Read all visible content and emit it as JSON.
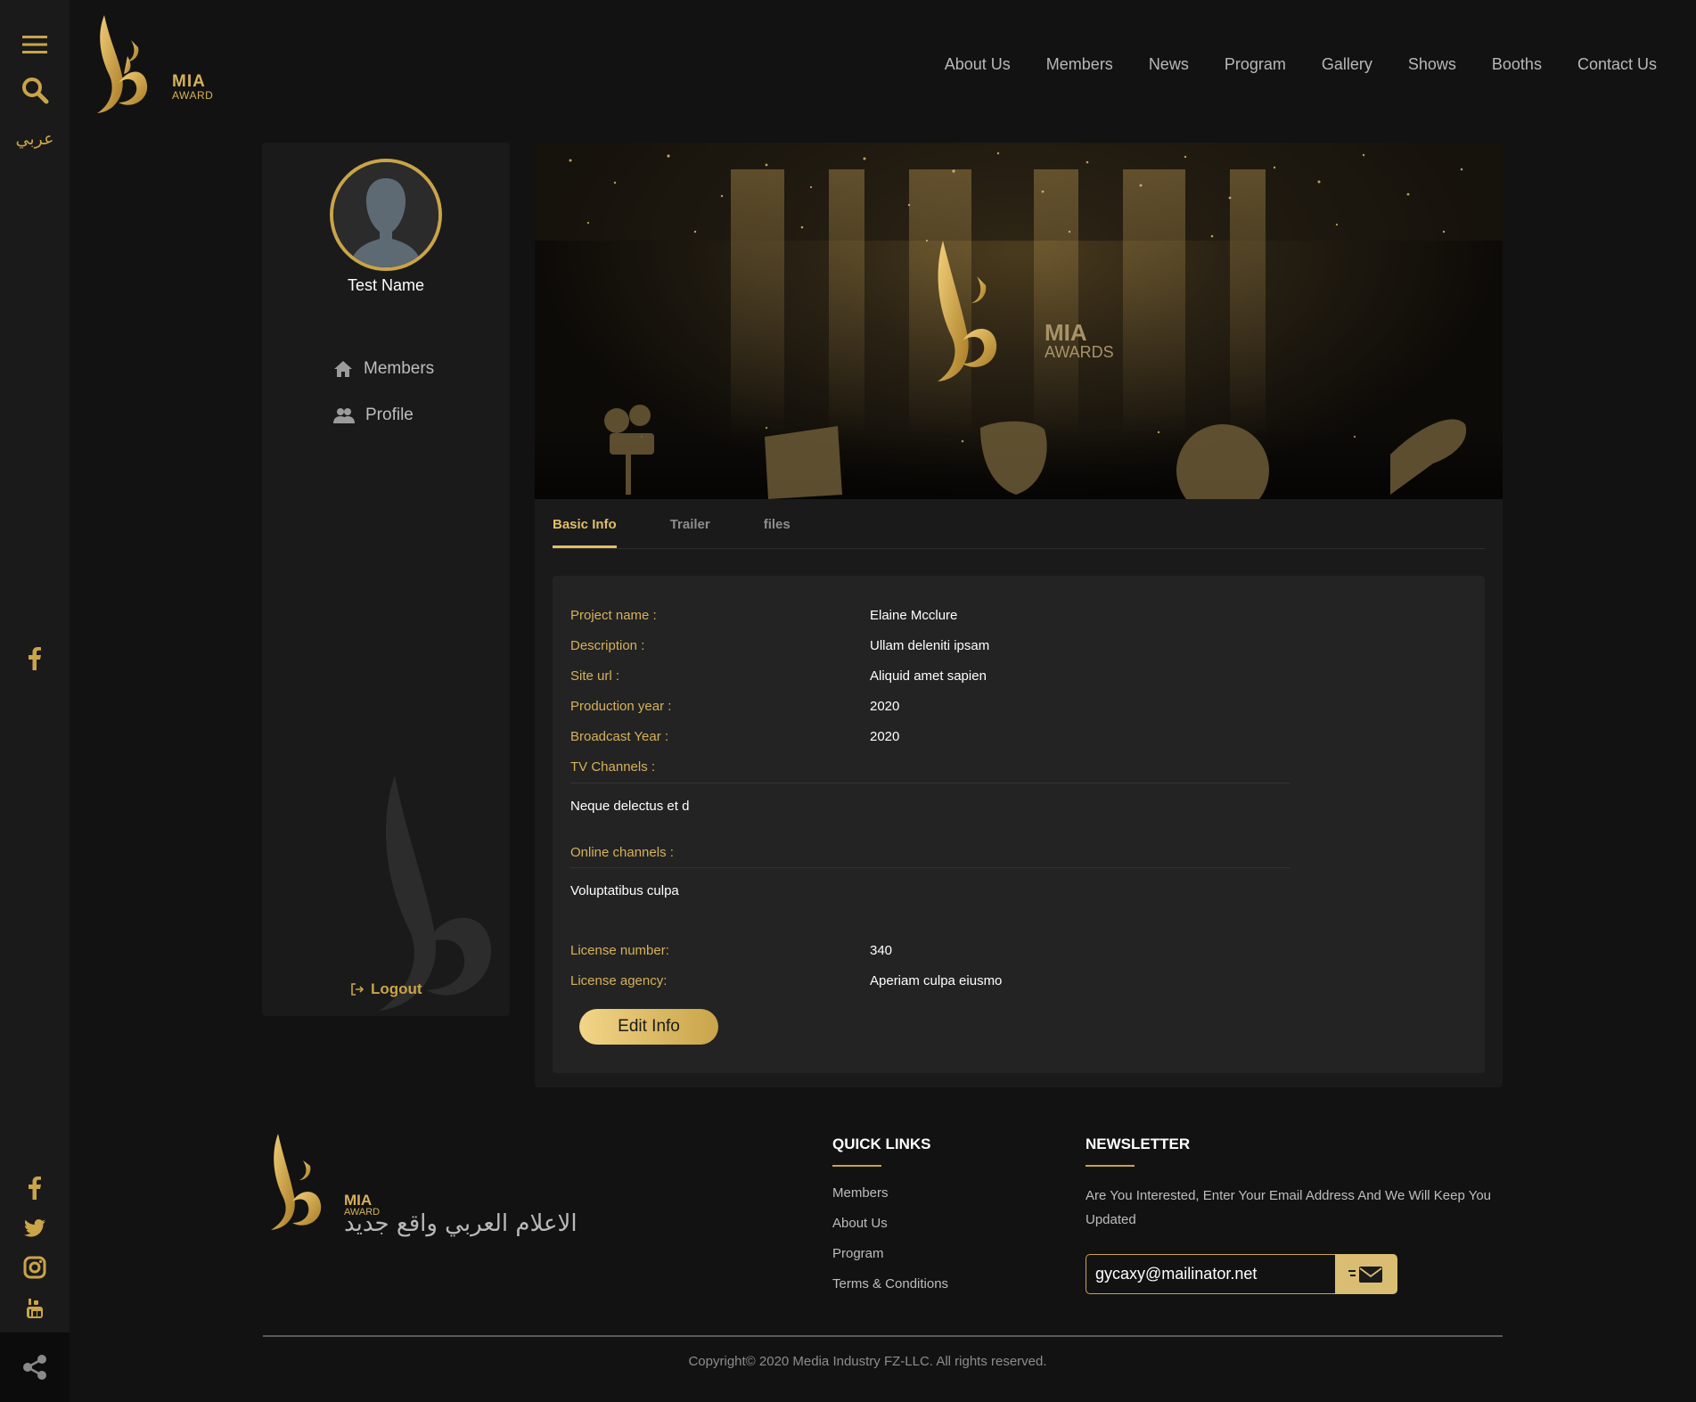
{
  "rail": {
    "lang_label": "عربي"
  },
  "brand": {
    "name": "MIA",
    "sub": "AWARD",
    "banner_name": "MIA",
    "banner_sub": "AWARDS",
    "tagline": "الاعلام العربي واقع جديد"
  },
  "nav": [
    "About Us",
    "Members",
    "News",
    "Program",
    "Gallery",
    "Shows",
    "Booths",
    "Contact Us"
  ],
  "sidebar": {
    "user_name": "Test Name",
    "items": [
      {
        "label": "Members",
        "icon": "home-icon"
      },
      {
        "label": "Profile",
        "icon": "users-icon"
      }
    ],
    "logout": "Logout"
  },
  "tabs": [
    {
      "label": "Basic Info",
      "active": true
    },
    {
      "label": "Trailer",
      "active": false
    },
    {
      "label": "files",
      "active": false
    }
  ],
  "info": {
    "project_name_label": "Project name :",
    "project_name": "Elaine Mcclure",
    "description_label": "Description :",
    "description": "Ullam deleniti ipsam",
    "site_url_label": "Site url :",
    "site_url": "Aliquid amet sapien",
    "production_year_label": "Production year :",
    "production_year": "2020",
    "broadcast_year_label": "Broadcast Year :",
    "broadcast_year": "2020",
    "tv_channels_label": "TV Channels :",
    "tv_channels": "Neque delectus et d",
    "online_channels_label": "Online channels :",
    "online_channels": "Voluptatibus culpa",
    "license_number_label": "License number:",
    "license_number": "340",
    "license_agency_label": "License agency:",
    "license_agency": "Aperiam culpa eiusmo",
    "edit_label": "Edit Info"
  },
  "footer": {
    "quick_links_title": "QUICK LINKS",
    "quick_links": [
      "Members",
      "About Us",
      "Program",
      "Terms & Conditions"
    ],
    "newsletter_title": "NEWSLETTER",
    "newsletter_text": "Are You Interested, Enter Your Email Address And We Will Keep You Updated",
    "email_value": "gycaxy@mailinator.net",
    "copyright": "Copyright© 2020 Media Industry FZ-LLC. All rights reserved."
  },
  "colors": {
    "gold": "#c9a449",
    "gold_light": "#e1be69",
    "bg": "#121212",
    "panel": "#1a1a1a",
    "card": "#232323"
  }
}
